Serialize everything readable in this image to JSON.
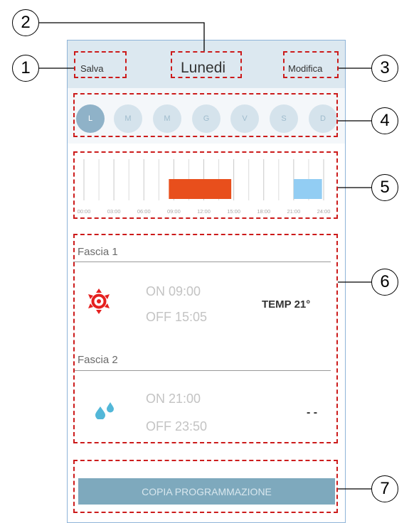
{
  "header": {
    "save_label": "Salva",
    "title": "Lunedi",
    "edit_label": "Modifica"
  },
  "days": [
    {
      "label": "L",
      "active": true
    },
    {
      "label": "M",
      "active": false
    },
    {
      "label": "M",
      "active": false
    },
    {
      "label": "G",
      "active": false
    },
    {
      "label": "V",
      "active": false
    },
    {
      "label": "S",
      "active": false
    },
    {
      "label": "D",
      "active": false
    }
  ],
  "timeline": {
    "ticks": [
      "00:00",
      "03:00",
      "06:00",
      "09:00",
      "12:00",
      "15:00",
      "18:00",
      "21:00",
      "24:00"
    ],
    "bars": [
      {
        "start": "08:30",
        "end": "14:45",
        "color": "#e84f1c"
      },
      {
        "start": "21:00",
        "end": "23:50",
        "color": "#92cdf3"
      }
    ]
  },
  "slots": [
    {
      "label": "Fascia 1",
      "icon": "sun-icon",
      "on": "ON 09:00",
      "off": "OFF 15:05",
      "value": "TEMP 21°",
      "icon_color": "#e5201f"
    },
    {
      "label": "Fascia 2",
      "icon": "water-drops-icon",
      "on": "ON 21:00",
      "off": "OFF 23:50",
      "value": "- -",
      "icon_color": "#52b7d8"
    }
  ],
  "copy_button_label": "COPIA PROGRAMMAZIONE",
  "callouts": [
    "1",
    "2",
    "3",
    "4",
    "5",
    "6",
    "7"
  ],
  "colors": {
    "header_bg": "#dce8f0",
    "day_active": "#8fb2c8",
    "day_inactive": "#d5e3ec",
    "annotation_red": "#cc1b1b",
    "button_bg": "#7ea9bd"
  }
}
